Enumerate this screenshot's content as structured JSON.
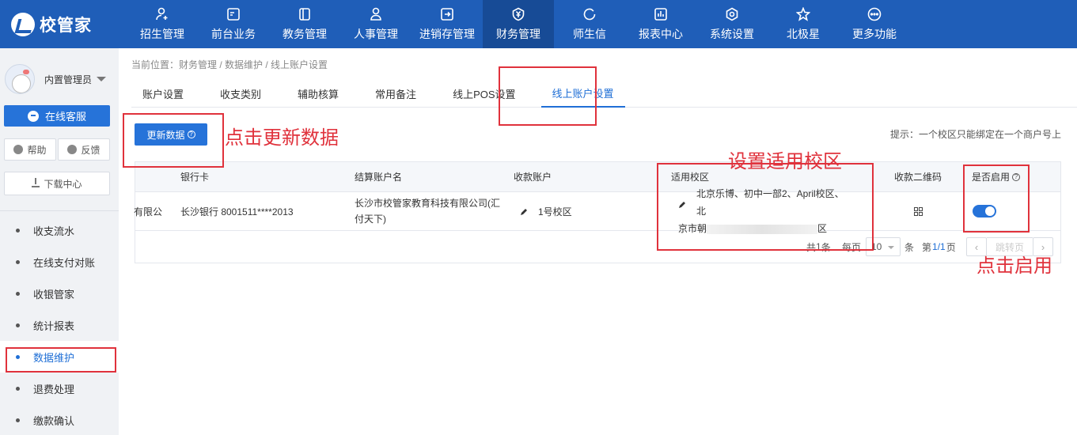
{
  "app": {
    "logo_text": "校管家"
  },
  "nav": [
    {
      "label": "招生管理",
      "icon": "user-plus-icon",
      "active": false
    },
    {
      "label": "前台业务",
      "icon": "card-icon",
      "active": false
    },
    {
      "label": "教务管理",
      "icon": "book-icon",
      "active": false
    },
    {
      "label": "人事管理",
      "icon": "person-icon",
      "active": false
    },
    {
      "label": "进销存管理",
      "icon": "exchange-icon",
      "active": false
    },
    {
      "label": "财务管理",
      "icon": "yen-shield-icon",
      "active": true
    },
    {
      "label": "师生信",
      "icon": "chat-icon",
      "active": false
    },
    {
      "label": "报表中心",
      "icon": "bar-chart-icon",
      "active": false
    },
    {
      "label": "系统设置",
      "icon": "settings-icon",
      "active": false
    },
    {
      "label": "北极星",
      "icon": "star-icon",
      "active": false
    },
    {
      "label": "更多功能",
      "icon": "more-icon",
      "active": false
    }
  ],
  "sidebar": {
    "user_name": "内置管理员",
    "online_service": "在线客服",
    "help": "帮助",
    "feedback": "反馈",
    "download_center": "下载中心",
    "menu": [
      {
        "label": "收支流水",
        "active": false
      },
      {
        "label": "在线支付对账",
        "active": false
      },
      {
        "label": "收银管家",
        "active": false
      },
      {
        "label": "统计报表",
        "active": false
      },
      {
        "label": "数据维护",
        "active": true
      },
      {
        "label": "退费处理",
        "active": false
      },
      {
        "label": "缴款确认",
        "active": false
      }
    ]
  },
  "breadcrumb": "当前位置：财务管理 / 数据维护 / 线上账户设置",
  "tabs": [
    {
      "label": "账户设置",
      "active": false
    },
    {
      "label": "收支类别",
      "active": false
    },
    {
      "label": "辅助核算",
      "active": false
    },
    {
      "label": "常用备注",
      "active": false
    },
    {
      "label": "线上POS设置",
      "active": false
    },
    {
      "label": "线上账户设置",
      "active": true
    }
  ],
  "toolbar": {
    "update_button": "更新数据",
    "tip": "提示：一个校区只能绑定在一个商户号上"
  },
  "table": {
    "columns": [
      "银行卡",
      "结算账户名",
      "收款账户",
      "适用校区",
      "收款二维码",
      "是否启用"
    ],
    "rows": [
      {
        "truncated_name": "有限公",
        "bank_card": "长沙银行 8001511****2013",
        "settle_account": "长沙市校管家教育科技有限公司(汇付天下)",
        "receive_account": "1号校区",
        "campus_line1": "北京乐博、初中一部2、April校区、北",
        "campus_line2_start": "京市朝",
        "campus_line2_end": "区",
        "enabled": true
      }
    ]
  },
  "pager": {
    "total_prefix": "共",
    "total": "1",
    "total_suffix": "条",
    "per_page_label": "每页",
    "page_size": "10",
    "page_size_suffix": "条",
    "page_prefix": "第",
    "page": "1/1",
    "page_suffix": "页",
    "jump_placeholder": "跳转页"
  },
  "annotations": {
    "click_update": "点击更新数据",
    "set_campus": "设置适用校区",
    "click_enable": "点击启用"
  },
  "colors": {
    "nav_bg": "#1f5eb8",
    "primary": "#2673d9",
    "annotation": "#e0323c"
  }
}
